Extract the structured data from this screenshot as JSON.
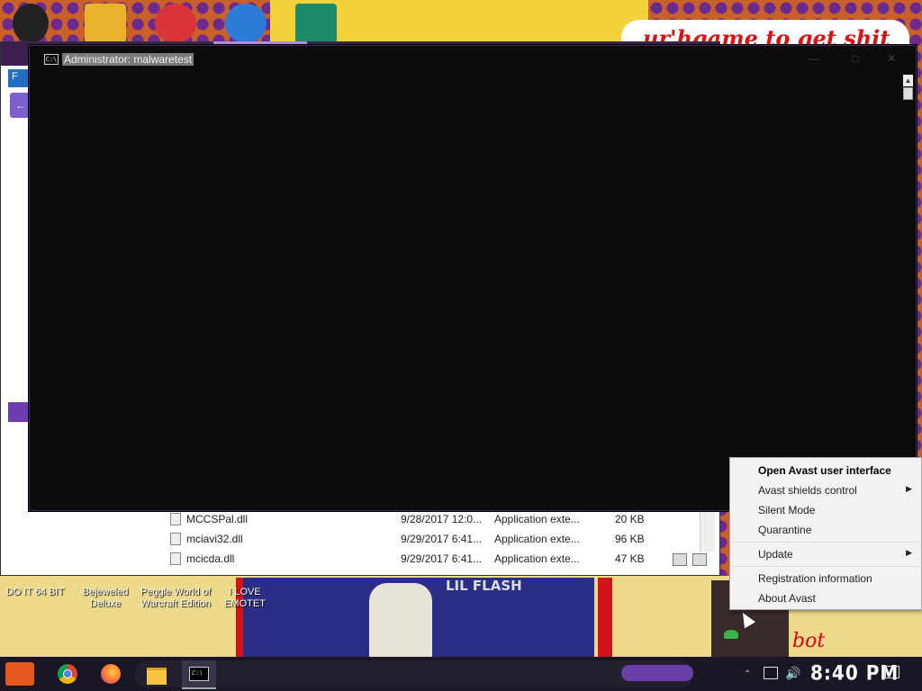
{
  "desktop": {
    "icons": [
      {
        "label": "DO IT 64 BIT",
        "icon": "shield-app-icon"
      },
      {
        "label": "Bejeweled Deluxe",
        "icon": "bejeweled-icon"
      },
      {
        "label": "Peggle World of Warcraft Edition",
        "icon": "peggle-icon"
      },
      {
        "label": "I LOVE EMOTET",
        "icon": "publisher-icon"
      }
    ],
    "wallpaper_text": "ur'hgame to get shit",
    "poster_title": "LIL FLASH",
    "bottom_right_text": "bot"
  },
  "explorer": {
    "tab_label": "F",
    "files": [
      {
        "name": "MCCSPal.dll",
        "date": "9/28/2017 12:0...",
        "type": "Application exte...",
        "size": "20 KB"
      },
      {
        "name": "mciavi32.dll",
        "date": "9/29/2017 6:41...",
        "type": "Application exte...",
        "size": "96 KB"
      },
      {
        "name": "mcicda.dll",
        "date": "9/29/2017 6:41...",
        "type": "Application exte...",
        "size": "47 KB"
      }
    ]
  },
  "cmd": {
    "icon_text": "C:\\",
    "title": "Administrator:  malwaretest",
    "minimize": "—",
    "maximize": "□",
    "close": "✕"
  },
  "context_menu": {
    "items": [
      {
        "label": "Open Avast user interface",
        "submenu": false
      },
      {
        "label": "Avast shields control",
        "submenu": true
      },
      {
        "label": "Silent Mode",
        "submenu": false
      },
      {
        "label": "Quarantine",
        "submenu": false
      },
      {
        "label": "Update",
        "submenu": true
      },
      {
        "label": "Registration information",
        "submenu": false
      },
      {
        "label": "About Avast",
        "submenu": false
      }
    ],
    "submenu_arrow": "▶"
  },
  "taskbar": {
    "pinned": [
      "start-icon",
      "chrome-icon",
      "firefox-icon",
      "file-explorer-icon",
      "command-prompt-icon"
    ],
    "cmd_icon_text": "C:\\",
    "tray_chevron": "⌃",
    "volume_glyph": "🔊",
    "clock": "8:40 PM"
  },
  "colors": {
    "taskbar": "#1a1624",
    "accent_purple": "#6b3fa8",
    "menu_bg": "#f2f2f2",
    "cmd_bg": "#0c0c0c"
  }
}
